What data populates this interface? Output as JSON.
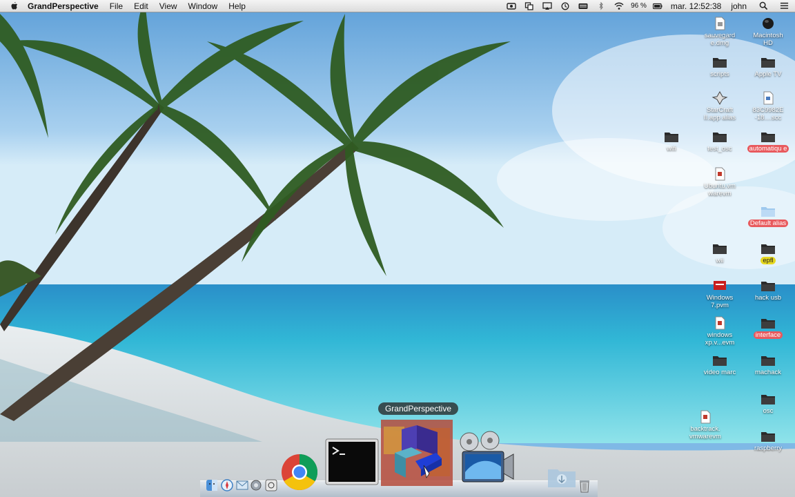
{
  "menubar": {
    "app_name": "GrandPerspective",
    "items": [
      "File",
      "Edit",
      "View",
      "Window",
      "Help"
    ],
    "battery_percent": "96 %",
    "clock": "mar. 12:52:38",
    "user": "john"
  },
  "desktop": {
    "icons": [
      {
        "label": "sauvegard e.dmg",
        "icon": "disk-image-icon"
      },
      {
        "label": "Macintosh HD",
        "icon": "hard-disk-icon"
      },
      {
        "label": "scripts",
        "icon": "folder-icon"
      },
      {
        "label": "Apple TV",
        "icon": "folder-icon"
      },
      {
        "label": "StarCraft II.app alias",
        "icon": "app-alias-icon"
      },
      {
        "label": "83C9982E -18....scc",
        "icon": "document-icon"
      },
      {
        "label": "wifi",
        "icon": "folder-icon"
      },
      {
        "label": "test_osc",
        "icon": "folder-icon"
      },
      {
        "label": "automatiqu e",
        "icon": "folder-icon",
        "tag": "red"
      },
      {
        "label": "Ubuntu.vm warevm",
        "icon": "vm-icon"
      },
      {
        "label": "Default alias",
        "icon": "folder-alias-icon",
        "tag": "red"
      },
      {
        "label": "wii",
        "icon": "folder-icon"
      },
      {
        "label": "epfl",
        "icon": "folder-icon",
        "tag": "yellow"
      },
      {
        "label": "Windows 7.pvm",
        "icon": "parallels-vm-icon"
      },
      {
        "label": "hack usb",
        "icon": "folder-icon"
      },
      {
        "label": "windows xp.v...evm",
        "icon": "vm-icon"
      },
      {
        "label": "interface",
        "icon": "folder-icon",
        "tag": "red"
      },
      {
        "label": "video marc",
        "icon": "folder-icon"
      },
      {
        "label": "machack",
        "icon": "folder-icon"
      },
      {
        "label": "osc",
        "icon": "folder-icon"
      },
      {
        "label": "backtrack. vmwarevm",
        "icon": "vm-icon"
      },
      {
        "label": "raspberry",
        "icon": "folder-icon"
      }
    ]
  },
  "dock": {
    "tooltip": "GrandPerspective",
    "items": [
      "finder-icon",
      "safari-icon",
      "mail-icon",
      "system-preferences-icon",
      "chrome-icon",
      "terminal-icon",
      "grandperspective-icon",
      "imovie-icon",
      "downloads-stack-icon",
      "trash-icon"
    ]
  },
  "colors": {
    "tag_red": "#e85a5e",
    "tag_yellow": "#e6d820"
  }
}
